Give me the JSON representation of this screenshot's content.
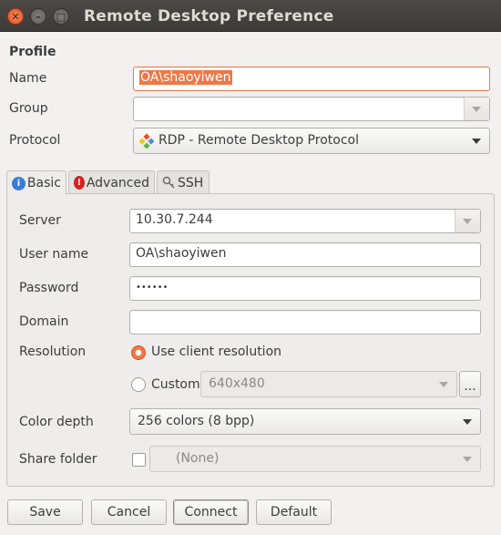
{
  "window": {
    "title": "Remote Desktop Preference",
    "close_glyph": "✕",
    "minimize_glyph": "–",
    "maximize_glyph": "□"
  },
  "profile": {
    "heading": "Profile",
    "name_label": "Name",
    "name_value": "OA\\shaoyiwen",
    "group_label": "Group",
    "group_value": "",
    "protocol_label": "Protocol",
    "protocol_value": "RDP - Remote Desktop Protocol"
  },
  "tabs": [
    {
      "label": "Basic",
      "icon": "info-icon",
      "active": true
    },
    {
      "label": "Advanced",
      "icon": "warning-icon",
      "active": false
    },
    {
      "label": "SSH",
      "icon": "key-icon",
      "active": false
    }
  ],
  "basic": {
    "server_label": "Server",
    "server_value": "10.30.7.244",
    "username_label": "User name",
    "username_value": "OA\\shaoyiwen",
    "password_label": "Password",
    "password_value": "••••••",
    "domain_label": "Domain",
    "domain_value": "",
    "resolution_label": "Resolution",
    "use_client_resolution": "Use client resolution",
    "custom_label": "Custom",
    "custom_value": "640x480",
    "more_button": "...",
    "color_depth_label": "Color depth",
    "color_depth_value": "256 colors (8 bpp)",
    "share_folder_label": "Share folder",
    "share_folder_value": "(None)"
  },
  "buttons": {
    "save": "Save",
    "cancel": "Cancel",
    "connect": "Connect",
    "default": "Default"
  },
  "colors": {
    "accent": "#f07746",
    "titlebar": "#3c3b37",
    "background": "#f2f1f0"
  }
}
